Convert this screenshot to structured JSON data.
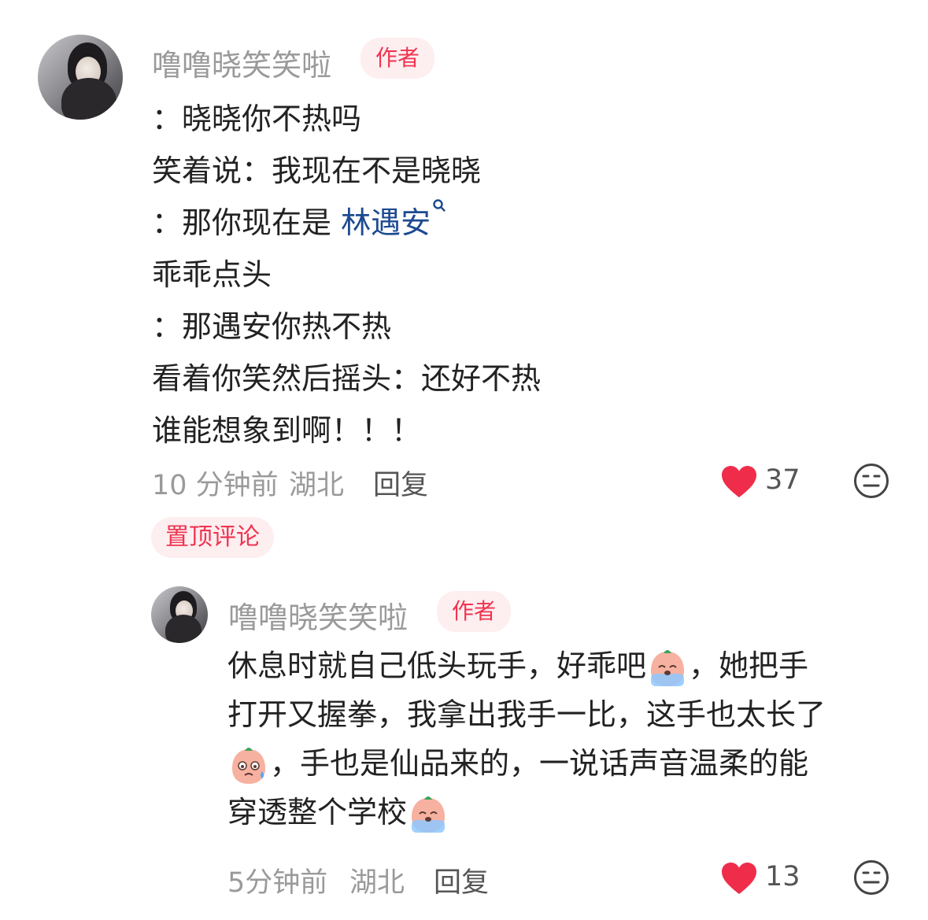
{
  "comment": {
    "author": "噜噜晓笑笑啦",
    "badge": "作者",
    "lines": {
      "l1": "：晓晓你不热吗",
      "l2": "笑着说：我现在不是晓晓",
      "l3_prefix": "：那你现在是 ",
      "l3_link": "林遇安",
      "l4": "乖乖点头",
      "l5": "：那遇安你热不热",
      "l6": "看着你笑然后摇头：还好不热",
      "l7": "谁能想象到啊！！！"
    },
    "time": "10 分钟前",
    "location": "湖北",
    "reply_label": "回复",
    "likes": "37"
  },
  "pinned_label": "置顶评论",
  "reply": {
    "author": "噜噜晓笑笑啦",
    "badge": "作者",
    "segments": {
      "s1": "休息时就自己低头玩手，好乖吧",
      "s2": "，她把手",
      "s3": "打开又握拳，我拿出我手一比，这手也太长了",
      "s4": "，手也是仙品来的，一说话声音温柔的能",
      "s5": "穿透整个学校"
    },
    "time": "5分钟前",
    "location": "湖北",
    "reply_label": "回复",
    "likes": "13"
  },
  "icons": {
    "like": "heart-icon",
    "dislike": "meh-face-icon",
    "search": "search-icon",
    "emoji_cry": "crying-peach-emoji",
    "emoji_sweat": "sweat-peach-emoji"
  },
  "colors": {
    "badge_text": "#f0344f",
    "badge_bg": "#fdeef0",
    "heart": "#ef2d4b",
    "link": "#1d4a91",
    "muted": "#9a9a9a"
  }
}
